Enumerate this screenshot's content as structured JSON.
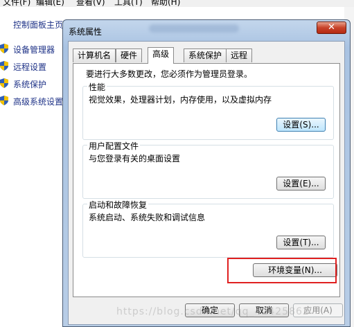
{
  "background_window": {
    "menu": [
      "文件(F)",
      "编辑(E)",
      "查看(V)",
      "工具(T)",
      "帮助(H)"
    ],
    "home_link": "控制面板主页",
    "nav_items": [
      {
        "label": "设备管理器",
        "icon": "uac-shield-icon"
      },
      {
        "label": "远程设置",
        "icon": "uac-shield-icon"
      },
      {
        "label": "系统保护",
        "icon": "uac-shield-icon"
      },
      {
        "label": "高级系统设置",
        "icon": "uac-shield-icon"
      }
    ]
  },
  "dialog": {
    "title": "系统属性",
    "close_label": "✕",
    "tabs": [
      {
        "label": "计算机名",
        "active": false
      },
      {
        "label": "硬件",
        "active": false
      },
      {
        "label": "高级",
        "active": true
      },
      {
        "label": "系统保护",
        "active": false
      },
      {
        "label": "远程",
        "active": false
      }
    ],
    "admin_note": "要进行大多数更改，您必须作为管理员登录。",
    "groups": [
      {
        "title": "性能",
        "description": "视觉效果，处理器计划，内存使用，以及虚拟内存",
        "button": "设置(S)..."
      },
      {
        "title": "用户配置文件",
        "description": "与您登录有关的桌面设置",
        "button": "设置(E)..."
      },
      {
        "title": "启动和故障恢复",
        "description": "系统启动、系统失败和调试信息",
        "button": "设置(T)..."
      }
    ],
    "env_button": "环境变量(N)...",
    "footer": {
      "ok": "确定",
      "cancel": "取消",
      "apply": "应用(A)"
    }
  },
  "colors": {
    "highlight_box": "#e02020",
    "link_blue": "#1e3287",
    "close_red": "#c8432a"
  },
  "watermark": "https://blog.csdn.net/qq_42425862"
}
